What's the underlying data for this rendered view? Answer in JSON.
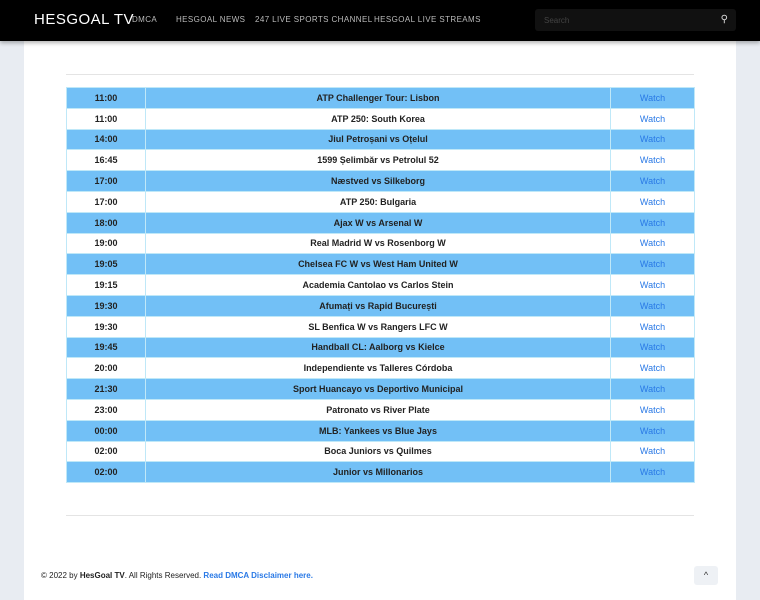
{
  "header": {
    "logo": "HESGOAL TV",
    "nav": [
      "DMCA",
      "HESGOAL NEWS",
      "247 LIVE SPORTS CHANNEL",
      "HESGOAL LIVE STREAMS"
    ],
    "search_placeholder": "Search"
  },
  "schedule": [
    {
      "time": "11:00",
      "event": "ATP Challenger Tour: Lisbon",
      "link": "Watch"
    },
    {
      "time": "11:00",
      "event": "ATP 250: South Korea",
      "link": "Watch"
    },
    {
      "time": "14:00",
      "event": "Jiul Petroșani vs Oțelul",
      "link": "Watch"
    },
    {
      "time": "16:45",
      "event": "1599 Șelimbăr vs Petrolul 52",
      "link": "Watch"
    },
    {
      "time": "17:00",
      "event": "Næstved vs Silkeborg",
      "link": "Watch"
    },
    {
      "time": "17:00",
      "event": "ATP 250: Bulgaria",
      "link": "Watch"
    },
    {
      "time": "18:00",
      "event": "Ajax W vs Arsenal W",
      "link": "Watch"
    },
    {
      "time": "19:00",
      "event": "Real Madrid W vs Rosenborg W",
      "link": "Watch"
    },
    {
      "time": "19:05",
      "event": "Chelsea FC W vs West Ham United W",
      "link": "Watch"
    },
    {
      "time": "19:15",
      "event": "Academia Cantolao vs Carlos Stein",
      "link": "Watch"
    },
    {
      "time": "19:30",
      "event": "Afumați vs Rapid București",
      "link": "Watch"
    },
    {
      "time": "19:30",
      "event": "SL Benfica W vs Rangers LFC W",
      "link": "Watch"
    },
    {
      "time": "19:45",
      "event": "Handball CL: Aalborg vs Kielce",
      "link": "Watch"
    },
    {
      "time": "20:00",
      "event": "Independiente vs Talleres Córdoba",
      "link": "Watch"
    },
    {
      "time": "21:30",
      "event": "Sport Huancayo vs Deportivo Municipal",
      "link": "Watch"
    },
    {
      "time": "23:00",
      "event": "Patronato vs River Plate",
      "link": "Watch"
    },
    {
      "time": "00:00",
      "event": "MLB: Yankees vs Blue Jays",
      "link": "Watch"
    },
    {
      "time": "02:00",
      "event": "Boca Juniors vs Quilmes",
      "link": "Watch"
    },
    {
      "time": "02:00",
      "event": "Junior vs Millonarios",
      "link": "Watch"
    }
  ],
  "footer": {
    "copyright": "© 2022 by ",
    "brand": "HesGoal TV",
    "rights": ". All Rights Reserved. ",
    "dmca_link": "Read DMCA Disclaimer here."
  },
  "back_to_top": "^"
}
